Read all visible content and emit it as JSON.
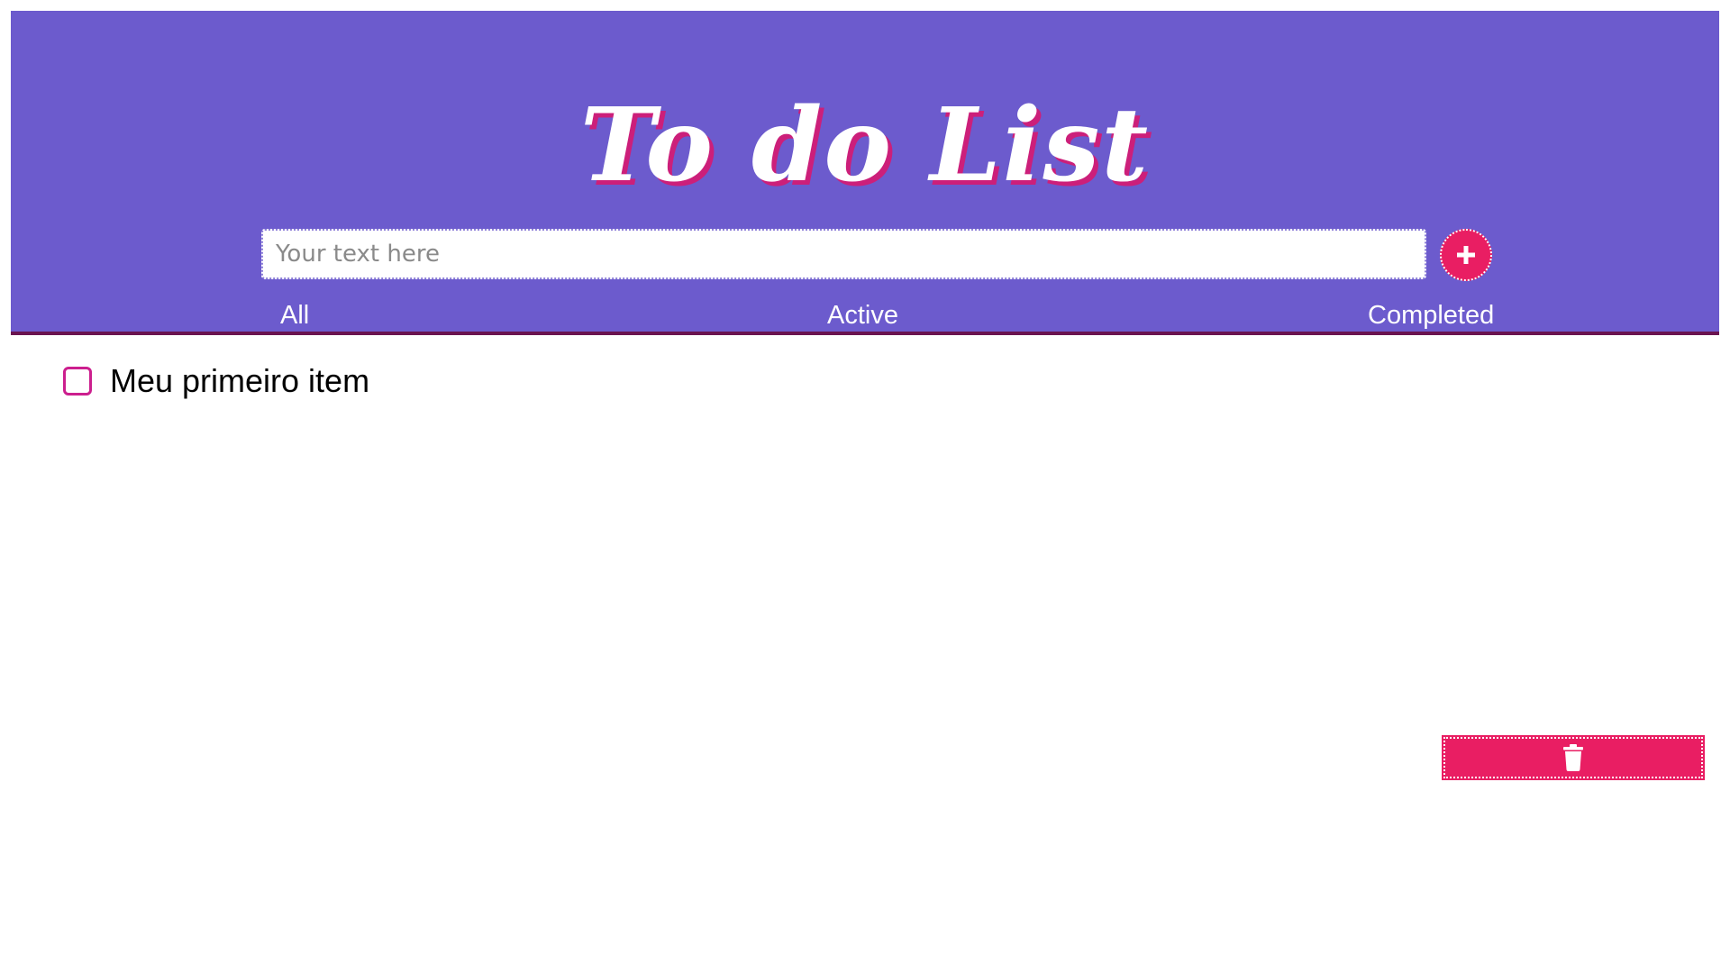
{
  "header": {
    "title": "To do List"
  },
  "new_item": {
    "placeholder": "Your text here",
    "value": "",
    "add_icon": "plus-icon"
  },
  "tabs": [
    {
      "label": "All"
    },
    {
      "label": "Active"
    },
    {
      "label": "Completed"
    }
  ],
  "items": [
    {
      "label": "Meu primeiro item",
      "completed": false
    }
  ],
  "actions": {
    "clear_icon": "trash-icon"
  },
  "colors": {
    "header_bg": "#6c5bcd",
    "header_border": "#6a1450",
    "accent": "#e91e63",
    "checkbox_border": "#cc1f8e",
    "title_shadow": "#cc1f7a"
  }
}
